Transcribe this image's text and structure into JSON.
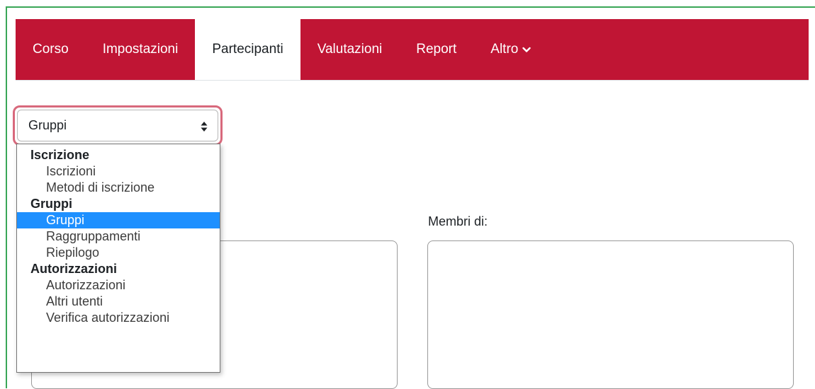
{
  "nav": {
    "items": [
      {
        "label": "Corso"
      },
      {
        "label": "Impostazioni"
      },
      {
        "label": "Partecipanti",
        "active": true
      },
      {
        "label": "Valutazioni"
      },
      {
        "label": "Report"
      },
      {
        "label": "Altro",
        "icon": "chevron-down-icon"
      }
    ],
    "accent_color": "#c01534"
  },
  "select": {
    "value": "Gruppi",
    "icon": "sort-arrows-icon"
  },
  "dropdown": {
    "groups": [
      {
        "label": "Iscrizione",
        "options": [
          "Iscrizioni",
          "Metodi di iscrizione"
        ]
      },
      {
        "label": "Gruppi",
        "options": [
          "Gruppi",
          "Raggruppamenti",
          "Riepilogo"
        ]
      },
      {
        "label": "Autorizzazioni",
        "options": [
          "Autorizzazioni",
          "Altri utenti",
          "Verifica autorizzazioni"
        ]
      }
    ],
    "selected": "Gruppi",
    "selected_color": "#1e90ff"
  },
  "members": {
    "label": "Membri di:"
  }
}
